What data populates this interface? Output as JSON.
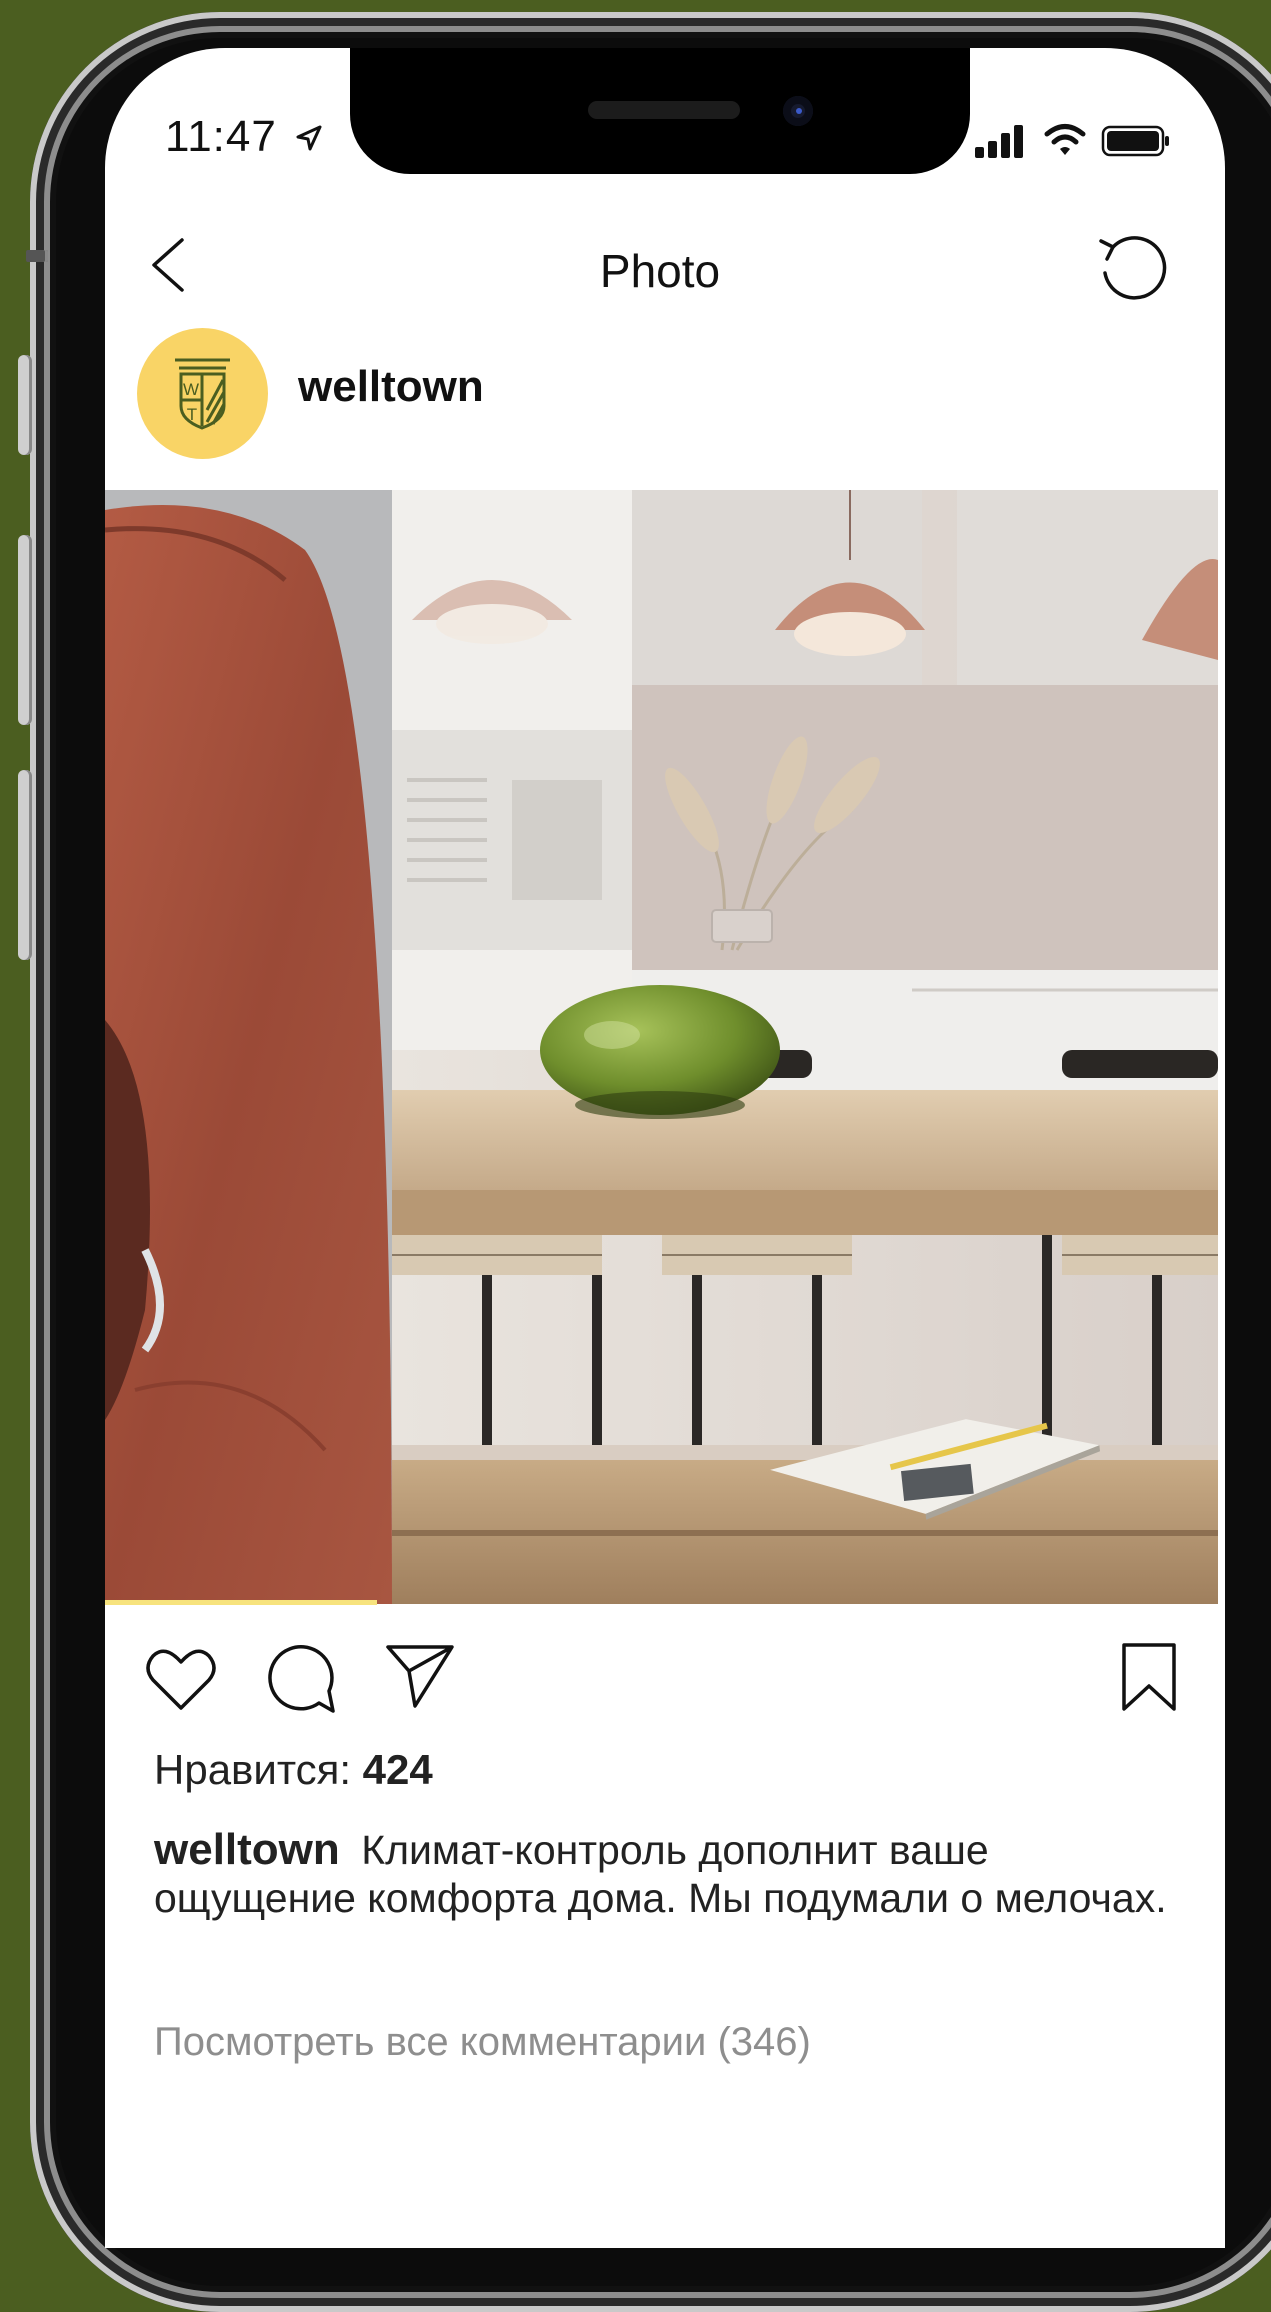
{
  "status_bar": {
    "time": "11:47"
  },
  "nav": {
    "title": "Photo"
  },
  "post": {
    "username": "welltown",
    "likes_label": "Нравится:",
    "likes_count": "424",
    "caption_user": "welltown",
    "caption_text": "Климат-контроль дополнит ваше ощущение комфорта дома. Мы подумали о мелочах.",
    "view_comments": "Посмотреть все комментарии (346)"
  },
  "avatar": {
    "logo_letters": "WT",
    "background": "#f9d466",
    "logo_color": "#4b5e20"
  },
  "icons": [
    "back-icon",
    "refresh-icon",
    "heart-icon",
    "comment-icon",
    "share-icon",
    "bookmark-icon",
    "location-arrow-icon",
    "signal-icon",
    "wifi-icon",
    "battery-icon"
  ],
  "colors": {
    "background": "#4b5e20",
    "screen": "#ffffff",
    "hood": "#a2503c",
    "vase": "#6f8e2c"
  }
}
